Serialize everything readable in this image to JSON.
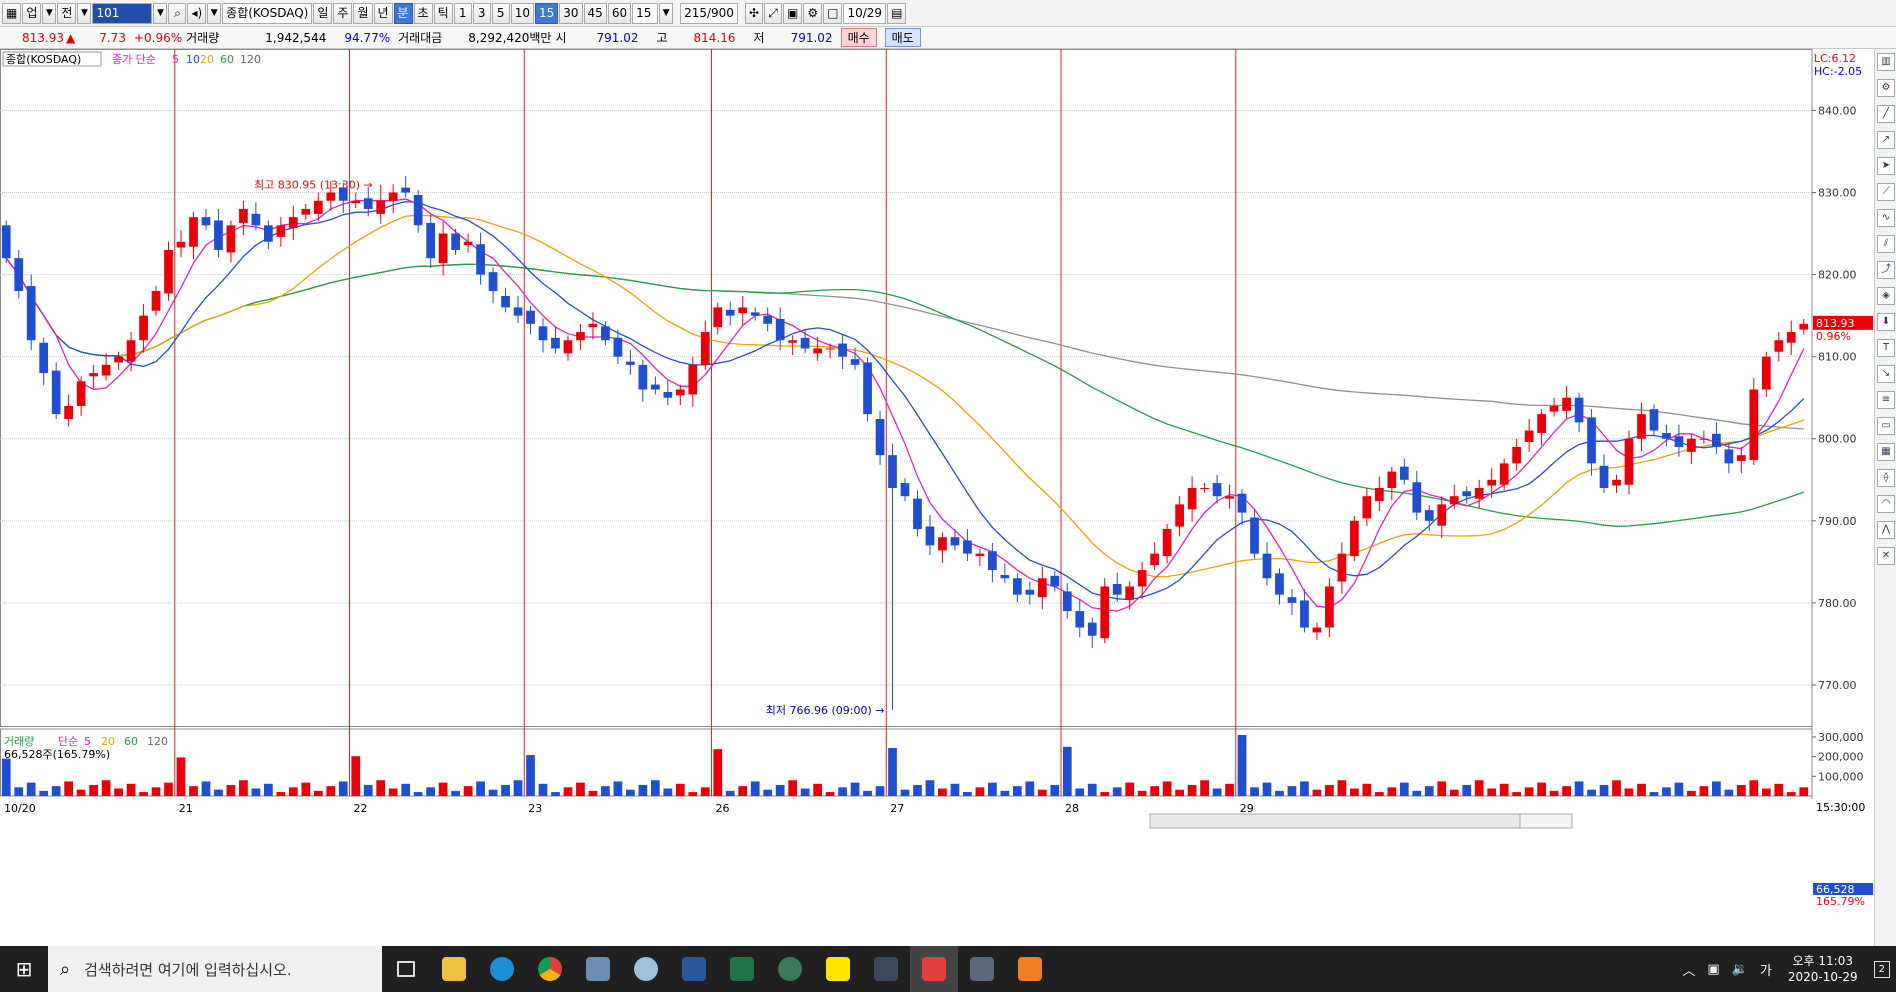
{
  "toolbar": {
    "items": [
      "업",
      "전",
      "101",
      "종합(KOSDAQ)",
      "일",
      "주",
      "월",
      "년",
      "분",
      "초",
      "틱",
      "1",
      "3",
      "5",
      "10",
      "15",
      "30",
      "45",
      "60",
      "15",
      "215/900",
      "10/29"
    ],
    "selected_period": "15",
    "selected_unit": "분"
  },
  "info": {
    "price": "813.93",
    "change_arrow": "▲",
    "change": "7.73",
    "change_pct": "+0.96%",
    "vol_label": "거래량",
    "volume": "1,942,544",
    "vol_ratio": "94.77%",
    "amount_label": "거래대금",
    "amount": "8,292,420백만",
    "open_label": "시",
    "open": "791.02",
    "high_label": "고",
    "high": "814.16",
    "low_label": "저",
    "low": "791.02",
    "buy": "매수",
    "sell": "매도"
  },
  "price_legend": {
    "name": "종합(KOSDAQ)",
    "ma_label": "종가 단순",
    "ma": [
      "5",
      "10",
      "20",
      "60",
      "120"
    ]
  },
  "price_axis": {
    "ticks": [
      "840.00",
      "830.00",
      "820.00",
      "810.00",
      "800.00",
      "790.00",
      "780.00",
      "770.00"
    ],
    "lc": "LC:6.12",
    "hc": "HC:-2.05",
    "current": "813.93",
    "current_pct": "0.96%"
  },
  "annotations": {
    "high": "최고 830.95 (13:30)",
    "low": "최저 766.96 (09:00)"
  },
  "volume_legend": {
    "name": "거래량",
    "ma_label": "단순",
    "ma": [
      "5",
      "20",
      "60",
      "120"
    ],
    "value": "66,528주(165.79%)"
  },
  "volume_axis": {
    "ticks": [
      "300,000",
      "200,000",
      "100,000"
    ],
    "current": "66,528",
    "current_pct": "165.79%"
  },
  "dates": [
    "10/20",
    "21",
    "22",
    "23",
    "26",
    "27",
    "28",
    "29"
  ],
  "time_label": "15:30:00",
  "colors": {
    "up": "#e8000b",
    "down": "#1f4fd0",
    "ma5": "#e020c0",
    "ma10": "#1f4fd0",
    "ma20": "#f0a000",
    "ma60": "#20a040",
    "ma120": "#909090",
    "session": "#e02020"
  },
  "chart_data": {
    "type": "candlestick",
    "interval": "15분",
    "series": [
      {
        "name": "종합(KOSDAQ)",
        "closes": [
          822,
          818,
          812,
          808,
          803,
          804,
          807,
          808,
          809,
          810,
          812,
          815,
          818,
          823,
          824,
          827,
          826,
          823,
          826,
          828,
          826,
          824,
          826,
          827,
          828,
          829,
          830,
          829,
          829,
          828,
          829,
          830,
          830,
          826,
          822,
          825,
          823,
          824,
          820,
          818,
          816,
          815,
          814,
          812,
          811,
          812,
          813,
          814,
          812,
          810,
          809,
          806,
          806,
          805,
          806,
          809,
          813,
          816,
          815,
          816,
          815,
          814,
          812,
          812,
          811,
          811,
          811,
          810,
          809,
          803,
          798,
          794,
          793,
          789,
          787,
          788,
          787,
          786,
          786,
          784,
          783,
          781,
          781,
          783,
          782,
          779,
          777,
          776,
          782,
          781,
          782,
          784,
          786,
          789,
          792,
          794,
          794,
          793,
          793,
          791,
          786,
          783,
          781,
          780,
          777,
          777,
          782,
          786,
          790,
          793,
          794,
          796,
          795,
          791,
          790,
          792,
          793,
          793,
          794,
          795,
          797,
          799,
          801,
          803,
          804,
          805,
          802,
          797,
          794,
          795,
          800,
          803,
          801,
          800,
          799,
          800,
          800,
          799,
          797,
          798,
          806,
          810,
          812,
          813,
          814
        ]
      }
    ],
    "ma": [
      "5",
      "10",
      "20",
      "60",
      "120"
    ],
    "ylim": [
      765,
      847
    ],
    "high": 830.95,
    "low": 766.96
  },
  "taskbar": {
    "search": "검색하려면 여기에 입력하십시오.",
    "ampm": "오후 11:03",
    "date": "2020-10-29",
    "lang": "가",
    "notif": "2"
  }
}
